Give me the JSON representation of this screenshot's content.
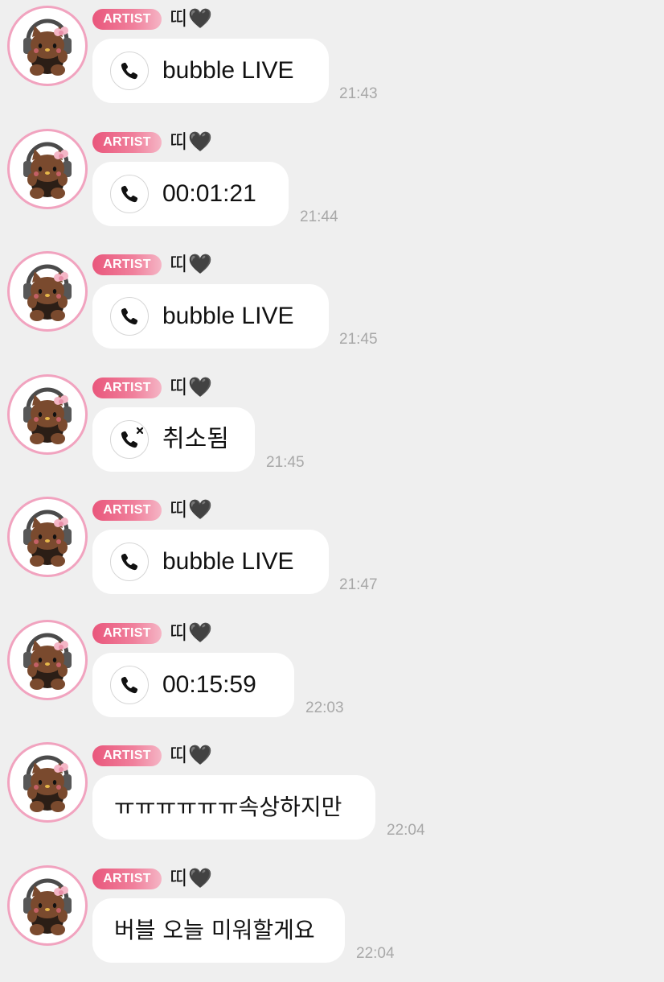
{
  "badge_label": "ARTIST",
  "sender_name": "띠",
  "name_emoji": "🖤",
  "avatar_icon": "hello-kitty-avatar-icon",
  "colors": {
    "background": "#efefef",
    "bubble": "#ffffff",
    "badge": "#e9577c",
    "avatar_ring": "#f1a3bf",
    "timestamp": "#a8a8a8"
  },
  "messages": [
    {
      "kind": "call",
      "icon": "phone-icon",
      "text": "bubble LIVE",
      "time": "21:43"
    },
    {
      "kind": "call",
      "icon": "phone-icon",
      "text": "00:01:21",
      "time": "21:44"
    },
    {
      "kind": "call",
      "icon": "phone-icon",
      "text": "bubble LIVE",
      "time": "21:45"
    },
    {
      "kind": "call",
      "icon": "phone-cancelled-icon",
      "text": "취소됨",
      "time": "21:45"
    },
    {
      "kind": "call",
      "icon": "phone-icon",
      "text": "bubble LIVE",
      "time": "21:47"
    },
    {
      "kind": "call",
      "icon": "phone-icon",
      "text": "00:15:59",
      "time": "22:03"
    },
    {
      "kind": "text",
      "text": "ㅠㅠㅠㅠㅠㅠ속상하지만",
      "time": "22:04"
    },
    {
      "kind": "text",
      "text": "버블 오늘 미워할게요",
      "time": "22:04"
    }
  ]
}
